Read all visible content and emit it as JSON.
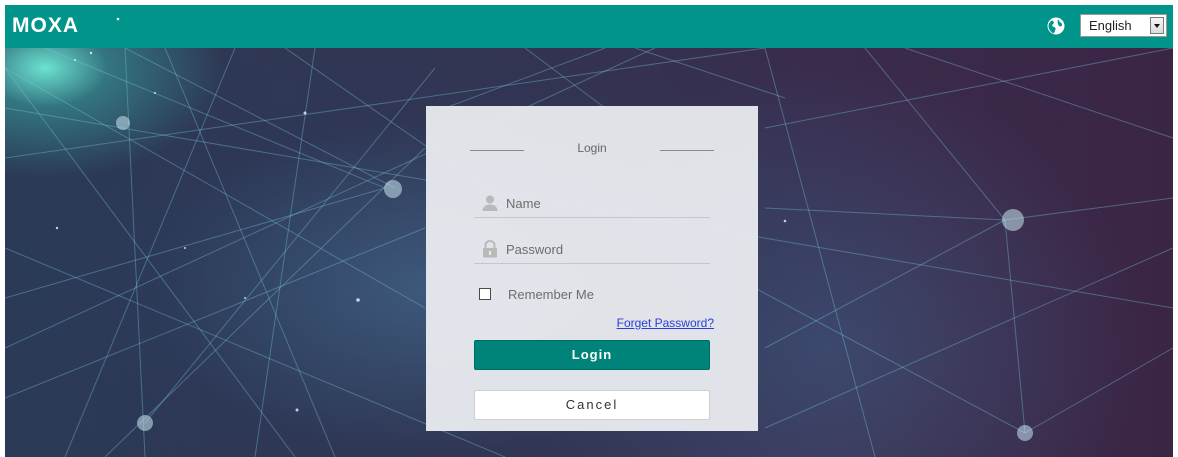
{
  "header": {
    "logo_text": "MOXA",
    "language_selected": "English",
    "globe_icon": "globe-icon",
    "brand_color": "#00948a"
  },
  "login": {
    "title": "Login",
    "name_placeholder": "Name",
    "password_placeholder": "Password",
    "remember_label": "Remember Me",
    "remember_checked": false,
    "forget_link": "Forget Password?",
    "login_button": "Login",
    "cancel_button": "Cancel",
    "icons": {
      "name": "user-icon",
      "password": "lock-icon"
    },
    "colors": {
      "login_button": "#00847a",
      "link": "#2a3fd4"
    }
  }
}
